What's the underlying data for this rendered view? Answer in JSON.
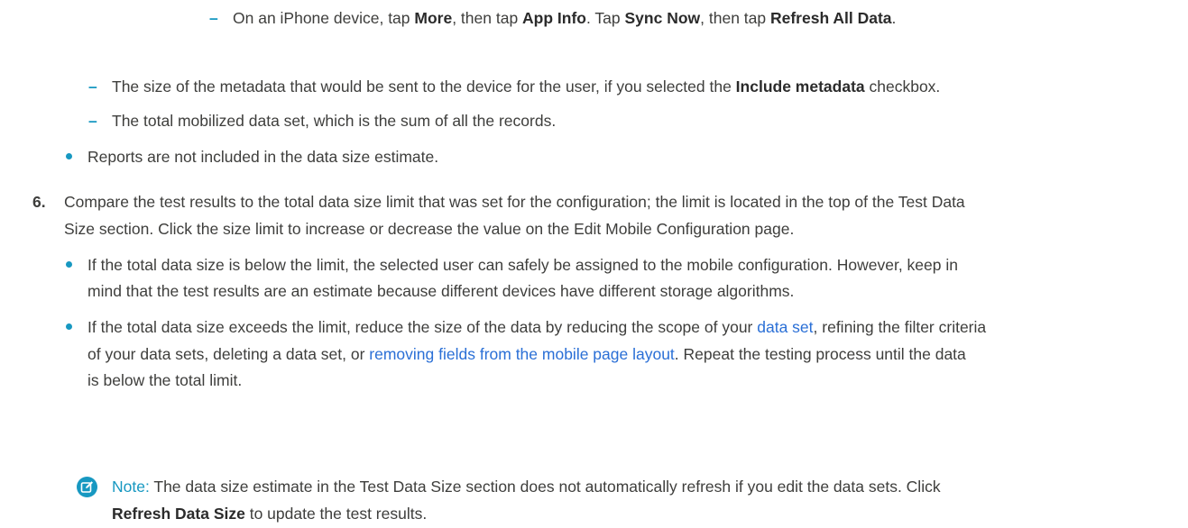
{
  "sub_items_top": [
    {
      "prefix": "On an iPhone device, tap ",
      "b1": "More",
      "mid1": ", then tap ",
      "b2": "App Info",
      "mid2": ". Tap ",
      "b3": "Sync Now",
      "mid3": ", then tap ",
      "b4": "Refresh All Data",
      "suffix": "."
    }
  ],
  "sub_items": [
    {
      "prefix": "The size of the metadata that would be sent to the device for the user, if you selected the ",
      "bold": "Include metadata",
      "suffix": " checkbox."
    },
    {
      "text": "The total mobilized data set, which is the sum of all the records."
    }
  ],
  "bullet_reports": "Reports are not included in the data size estimate.",
  "step6": {
    "number": "6.",
    "line1": "Compare the test results to the total data size limit that was set for the configuration; the limit is located in the top of the Test Data",
    "line2": "Size section. Click the size limit to increase or decrease the value on the Edit Mobile Configuration page.",
    "bullet1_line1": "If the total data size is below the limit, the selected user can safely be assigned to the mobile configuration. However, keep in",
    "bullet1_line2": "mind that the test results are an estimate because different devices have different storage algorithms.",
    "bullet2_line1_a": "If the total data size exceeds the limit, reduce the size of the data by reducing the scope of your ",
    "bullet2_link1": "data set",
    "bullet2_line1_b": ", refining the filter criteria",
    "bullet2_line2_a": "of your data sets, deleting a data set, or ",
    "bullet2_link2": "removing fields from the mobile page layout",
    "bullet2_line2_b": ". Repeat the testing process until the data",
    "bullet2_line3": "is below the total limit."
  },
  "note": {
    "icon": "note-edit-icon",
    "label": "Note:",
    "line1": " The data size estimate in the Test Data Size section does not automatically refresh if you edit the data sets. Click",
    "bold": "Refresh Data Size",
    "line2_suffix": " to update the test results."
  },
  "colors": {
    "accent": "#1798c1",
    "link": "#2a6fd6",
    "text": "#3e3e3c"
  }
}
